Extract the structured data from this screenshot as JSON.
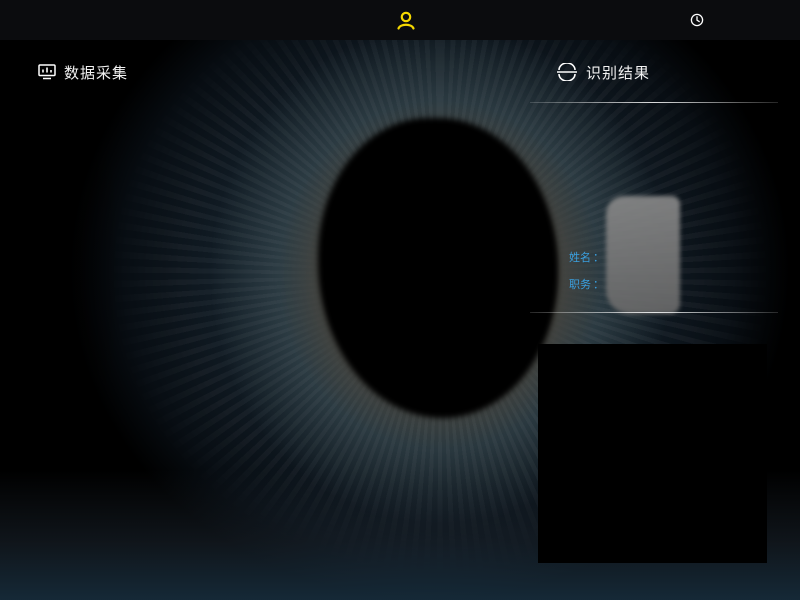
{
  "topbar": {
    "tabs": [
      {
        "id": "user",
        "icon": "user-icon",
        "color": "#f5d800"
      },
      {
        "id": "history",
        "icon": "clock-icon",
        "color": "#ffffff"
      }
    ]
  },
  "left_panel": {
    "title": "数据采集",
    "icon": "monitor-chart-icon"
  },
  "right_panel": {
    "title": "识别结果",
    "icon": "recognition-icon",
    "fields": [
      {
        "label": "姓名",
        "separator": "：",
        "value": ""
      },
      {
        "label": "职务",
        "separator": "：",
        "value": ""
      }
    ]
  },
  "colors": {
    "accent": "#f5d800",
    "label_blue": "#3aa0e0",
    "topbar_bg": "#0b0c0e"
  }
}
